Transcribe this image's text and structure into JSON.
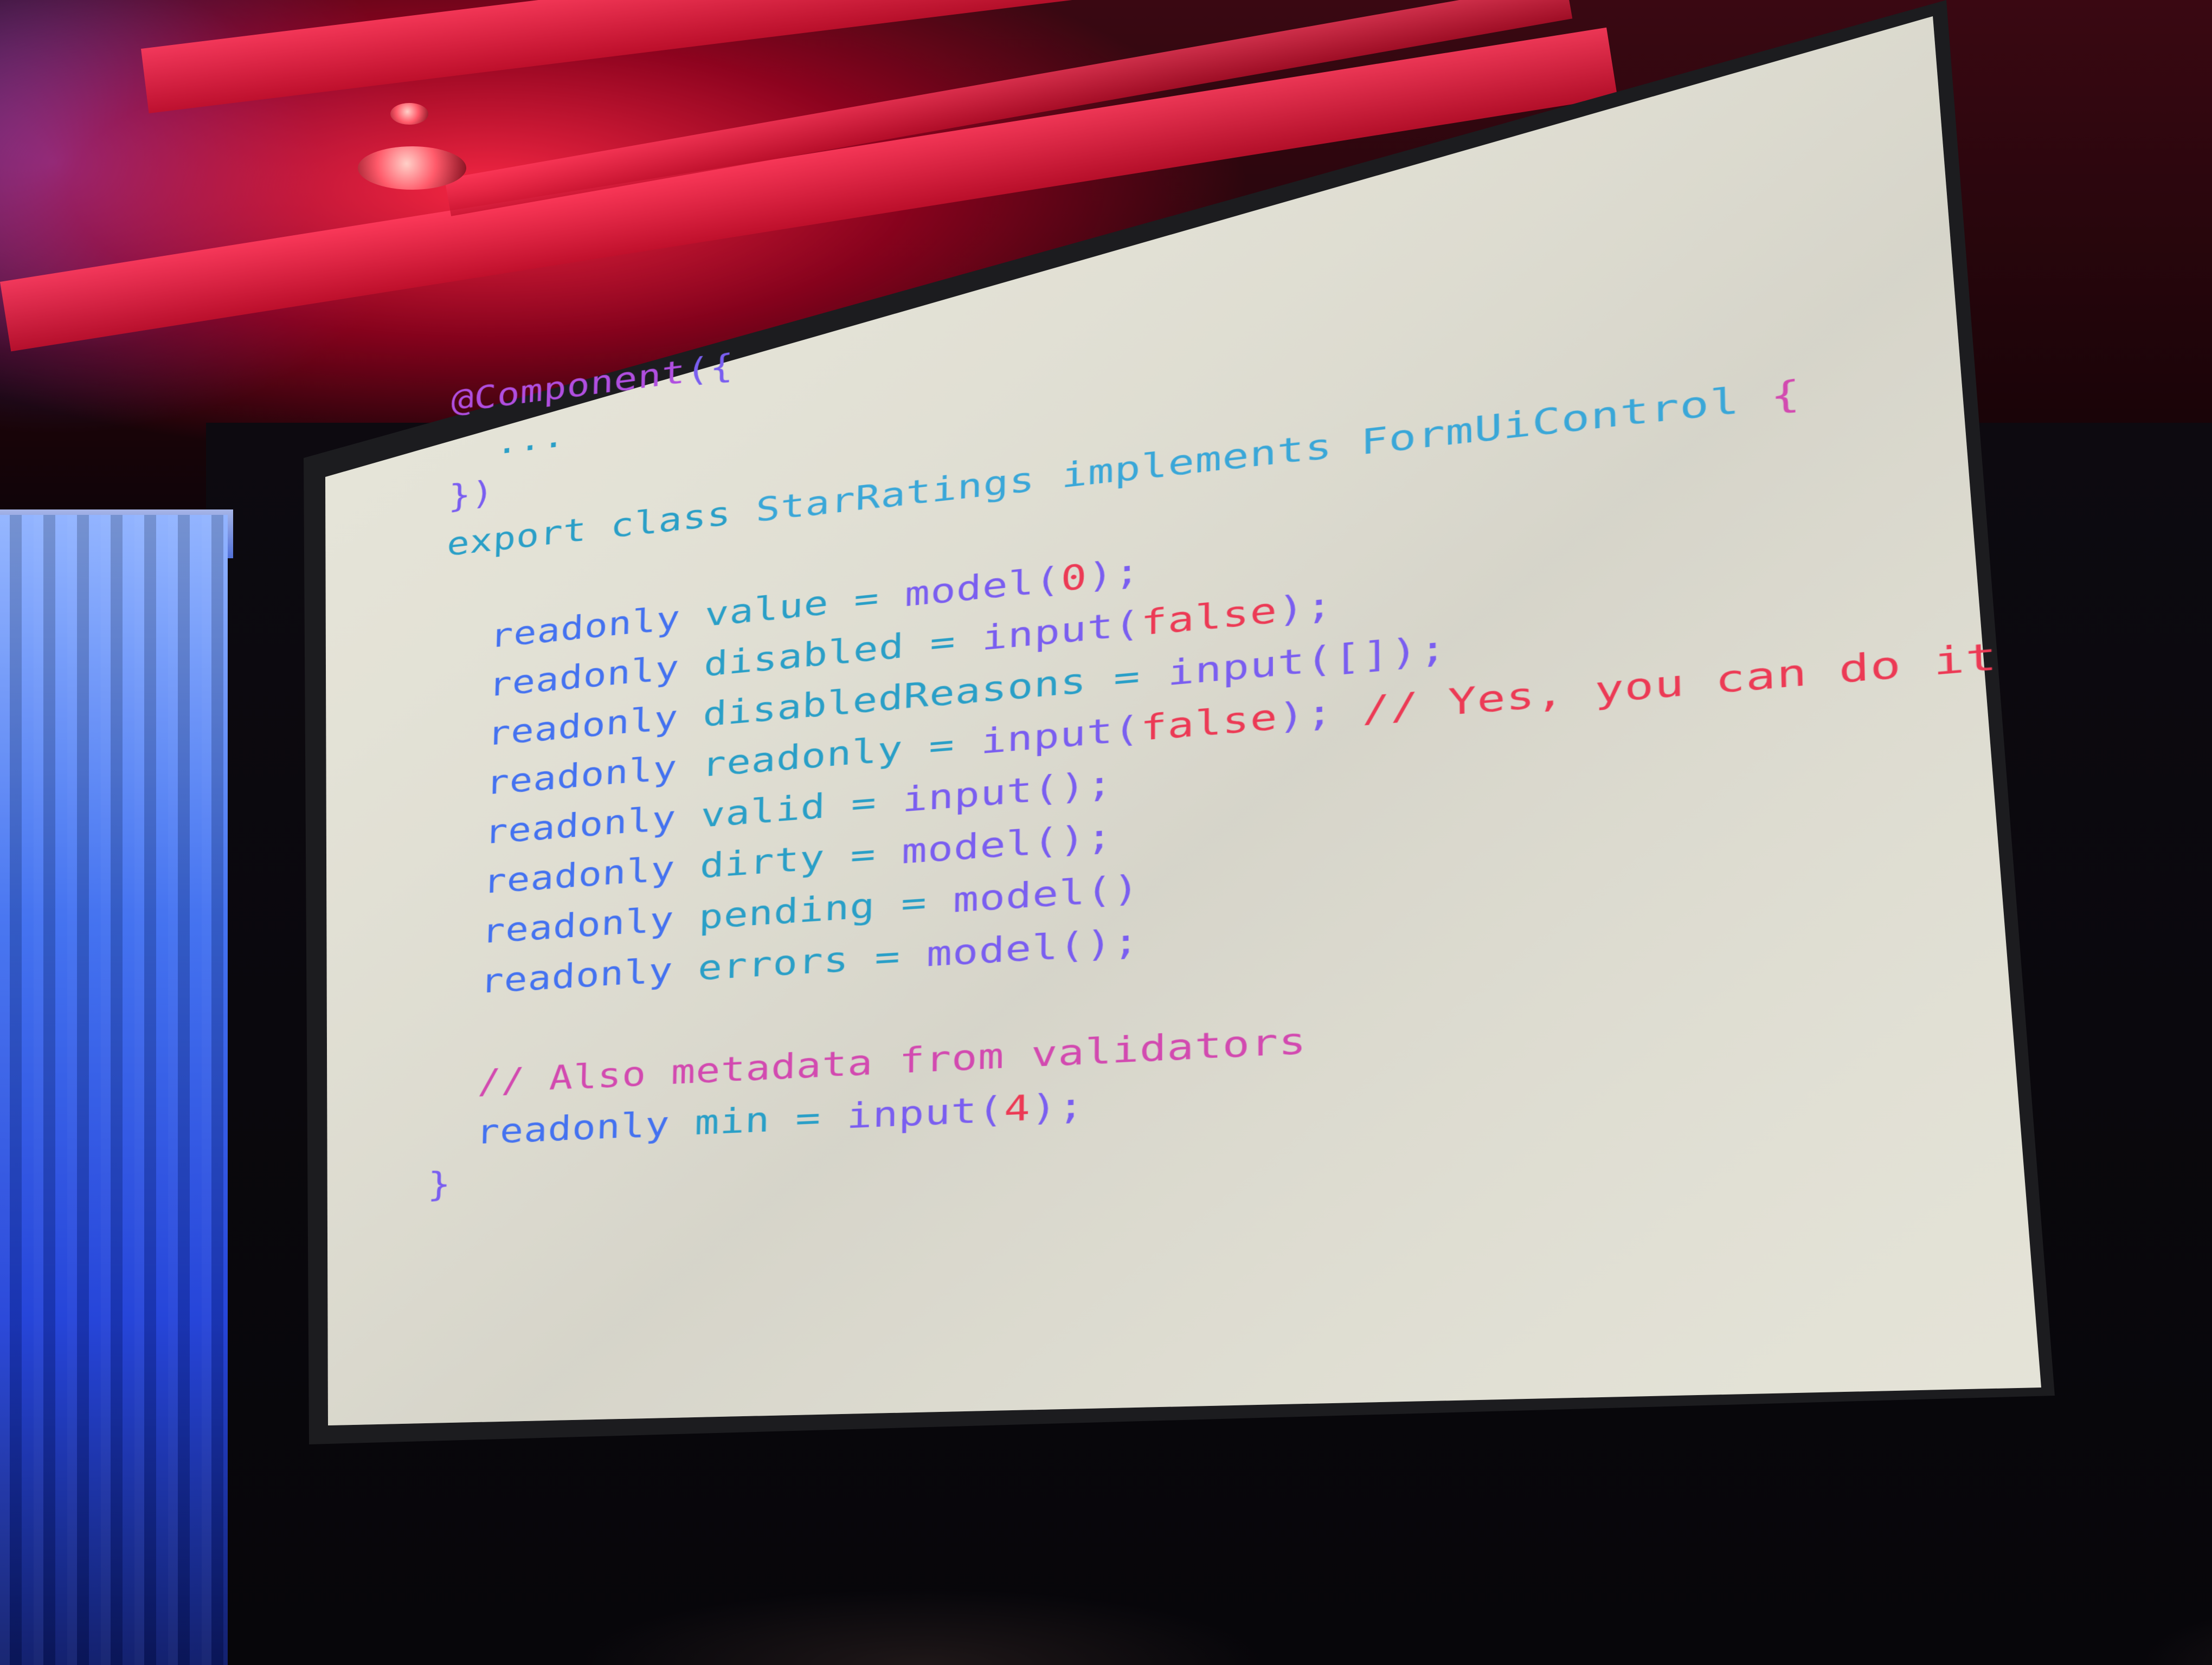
{
  "slide": {
    "logo_icon": "angular-logo-icon",
    "code_lines": [
      [
        {
          "t": "@Component",
          "c": "purple"
        },
        {
          "t": "({",
          "c": "violet"
        }
      ],
      [
        {
          "t": "  ...",
          "c": "teal"
        }
      ],
      [
        {
          "t": "})",
          "c": "violet"
        }
      ],
      [
        {
          "t": "export class ",
          "c": "teal"
        },
        {
          "t": "StarRatings ",
          "c": "cyan"
        },
        {
          "t": "implements ",
          "c": "cyan"
        },
        {
          "t": "FormUiControl ",
          "c": "cyan"
        },
        {
          "t": "{",
          "c": "pink"
        }
      ],
      [
        {
          "t": "",
          "c": "teal"
        }
      ],
      [
        {
          "t": "  readonly ",
          "c": "blue"
        },
        {
          "t": "value ",
          "c": "teal"
        },
        {
          "t": "= ",
          "c": "teal"
        },
        {
          "t": "model",
          "c": "violet"
        },
        {
          "t": "(",
          "c": "violet"
        },
        {
          "t": "0",
          "c": "red"
        },
        {
          "t": ");",
          "c": "violet"
        }
      ],
      [
        {
          "t": "  readonly ",
          "c": "blue"
        },
        {
          "t": "disabled ",
          "c": "teal"
        },
        {
          "t": "= ",
          "c": "teal"
        },
        {
          "t": "input",
          "c": "violet"
        },
        {
          "t": "(",
          "c": "violet"
        },
        {
          "t": "false",
          "c": "red"
        },
        {
          "t": ");",
          "c": "violet"
        }
      ],
      [
        {
          "t": "  readonly ",
          "c": "blue"
        },
        {
          "t": "disabledReasons ",
          "c": "teal"
        },
        {
          "t": "= ",
          "c": "teal"
        },
        {
          "t": "input",
          "c": "violet"
        },
        {
          "t": "([]);",
          "c": "violet"
        }
      ],
      [
        {
          "t": "  readonly ",
          "c": "blue"
        },
        {
          "t": "readonly ",
          "c": "teal"
        },
        {
          "t": "= ",
          "c": "teal"
        },
        {
          "t": "input",
          "c": "violet"
        },
        {
          "t": "(",
          "c": "violet"
        },
        {
          "t": "false",
          "c": "red"
        },
        {
          "t": "); ",
          "c": "violet"
        },
        {
          "t": "// Yes, you can do it",
          "c": "red"
        }
      ],
      [
        {
          "t": "  readonly ",
          "c": "blue"
        },
        {
          "t": "valid ",
          "c": "teal"
        },
        {
          "t": "= ",
          "c": "teal"
        },
        {
          "t": "input",
          "c": "violet"
        },
        {
          "t": "();",
          "c": "violet"
        }
      ],
      [
        {
          "t": "  readonly ",
          "c": "blue"
        },
        {
          "t": "dirty ",
          "c": "teal"
        },
        {
          "t": "= ",
          "c": "teal"
        },
        {
          "t": "model",
          "c": "violet"
        },
        {
          "t": "();",
          "c": "violet"
        }
      ],
      [
        {
          "t": "  readonly ",
          "c": "blue"
        },
        {
          "t": "pending ",
          "c": "teal"
        },
        {
          "t": "= ",
          "c": "teal"
        },
        {
          "t": "model",
          "c": "violet"
        },
        {
          "t": "()",
          "c": "violet"
        }
      ],
      [
        {
          "t": "  readonly ",
          "c": "blue"
        },
        {
          "t": "errors ",
          "c": "teal"
        },
        {
          "t": "= ",
          "c": "teal"
        },
        {
          "t": "model",
          "c": "violet"
        },
        {
          "t": "();",
          "c": "violet"
        }
      ],
      [
        {
          "t": "",
          "c": "teal"
        }
      ],
      [
        {
          "t": "  // Also metadata from validators",
          "c": "pink"
        }
      ],
      [
        {
          "t": "  readonly ",
          "c": "blue"
        },
        {
          "t": "min ",
          "c": "teal"
        },
        {
          "t": "= ",
          "c": "teal"
        },
        {
          "t": "input",
          "c": "violet"
        },
        {
          "t": "(",
          "c": "violet"
        },
        {
          "t": "4",
          "c": "red"
        },
        {
          "t": ");",
          "c": "violet"
        }
      ],
      [
        {
          "t": "}",
          "c": "violet"
        }
      ]
    ]
  },
  "colors": {
    "purple": "#b04ee0",
    "blue": "#4472f0",
    "teal": "#2a9fc7",
    "cyan": "#3aa7d8",
    "red": "#ec3a55",
    "pink": "#d24ab0",
    "violet": "#7a5ef0",
    "slide_background": "#e4e3d8",
    "ceiling_light": "#ff2846",
    "curtain_light": "#3f6ff0"
  }
}
